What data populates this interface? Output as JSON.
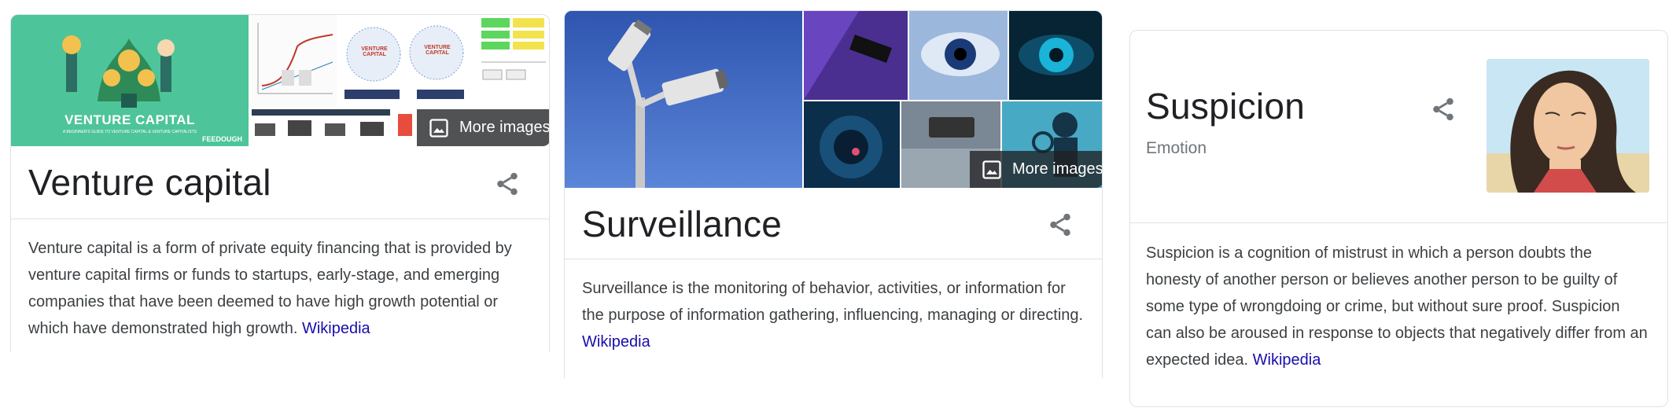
{
  "cards": [
    {
      "title": "Venture capital",
      "description": "Venture capital is a form of private equity financing that is provided by venture capital firms or funds to startups, early-stage, and emerging companies that have been deemed to have high growth potential or which have demonstrated high growth. ",
      "source_link": "Wikipedia",
      "more_images_label": "More images",
      "image_text": {
        "heading": "VENTURE CAPITAL",
        "caption": "A BEGINNER'S GUIDE TO VENTURE CAPITAL & VENTURE CAPITALISTS",
        "brand": "FEEDOUGH",
        "diagram_label": "VENTURE CAPITAL"
      }
    },
    {
      "title": "Surveillance",
      "description": "Surveillance is the monitoring of behavior, activities, or information for the purpose of information gathering, influencing, managing or directing. ",
      "source_link": "Wikipedia",
      "more_images_label": "More images"
    },
    {
      "title": "Suspicion",
      "subtitle": "Emotion",
      "description": "Suspicion is a cognition of mistrust in which a person doubts the honesty of another person or believes another person to be guilty of some type of wrongdoing or crime, but without sure proof. Suspicion can also be aroused in response to objects that negatively differ from an expected idea. ",
      "source_link": "Wikipedia"
    }
  ],
  "icons": {
    "share": "share-icon",
    "more_images": "image-icon"
  },
  "colors": {
    "link": "#1a0dab",
    "title": "#202124",
    "body_text": "#3c4043",
    "muted": "#70757a",
    "border": "#dfe1e5",
    "vc_green": "#4ec49a"
  }
}
